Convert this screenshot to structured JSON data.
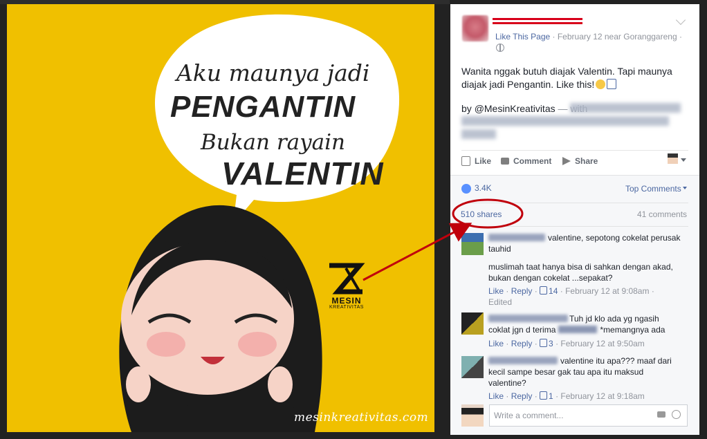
{
  "photo": {
    "quote_line1": "Aku maunya jadi",
    "quote_line2": "PENGANTIN",
    "quote_line3": "Bukan rayain",
    "quote_line4": "VALENTIN",
    "logo_line1": "MESIN",
    "logo_line2": "KREATIVITAS",
    "watermark": "mesinkreativitas.com",
    "bg_color": "#f0c000"
  },
  "post": {
    "meta_like_page": "Like This Page",
    "meta_sep": " · ",
    "meta_date_place": "February 12 near Goranggareng",
    "text": "Wanita nggak butuh diajak Valentin. Tapi maunya diajak jadi Pengantin. Like this!",
    "by_prefix": "by ",
    "by_handle": "@MesinKreativitas",
    "by_with": " — with"
  },
  "actions": {
    "like": "Like",
    "comment": "Comment",
    "share": "Share"
  },
  "stats": {
    "likes": "3.4K",
    "top_comments": "Top Comments",
    "shares": "510 shares",
    "comments": "41 comments"
  },
  "comments": [
    {
      "text": "valentine, sepotong cokelat perusak tauhid",
      "text2": "muslimah taat hanya bisa di sahkan dengan akad, bukan dengan cokelat ...sepakat?",
      "like": "Like",
      "reply": "Reply",
      "likes": "14",
      "time": "February 12 at 9:08am",
      "edited": "Edited"
    },
    {
      "text_a": "Tuh jd klo ada yg ngasih",
      "text_b": "coklat jgn d terima",
      "text_c": "*memangnya ada",
      "like": "Like",
      "reply": "Reply",
      "likes": "3",
      "time": "February 12 at 9:50am"
    },
    {
      "text": "valentine itu apa??? maaf dari kecil sampe besar gak tau apa itu maksud valentine?",
      "like": "Like",
      "reply": "Reply",
      "likes": "1",
      "time": "February 12 at 9:18am"
    }
  ],
  "write_comment": {
    "placeholder": "Write a comment..."
  },
  "colors": {
    "link": "#4b67a1",
    "annotation_red": "#c0000c"
  }
}
